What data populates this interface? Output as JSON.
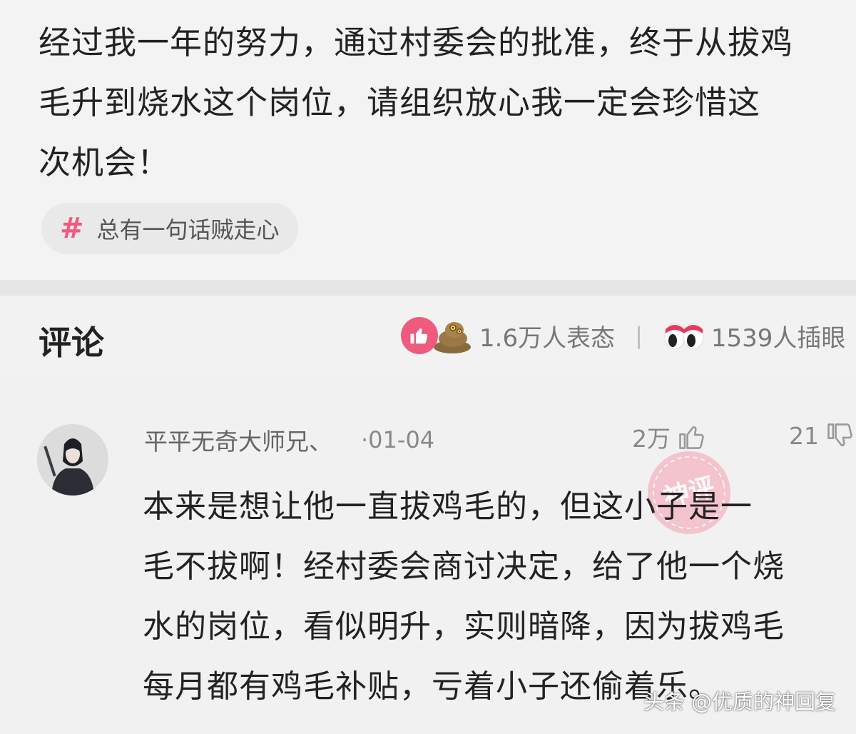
{
  "post": {
    "text": "经过我一年的努力，通过村委会的批准，终于从拔鸡\n毛升到烧水这个岗位，请组织放心我一定会珍惜这\n次机会！",
    "topic": {
      "hash": "#",
      "label": "总有一句话贼走心"
    }
  },
  "comments_header": {
    "title": "评论",
    "reactions_text": "1.6万人表态",
    "separator": "|",
    "eyes_text": "1539人插眼",
    "icons": [
      "like-reaction-icon",
      "poop-reaction-icon",
      "eyes-reaction-icon"
    ]
  },
  "comment": {
    "user": "平平无奇大师兄、",
    "date": "·01-04",
    "likes": "2万",
    "dislikes": "21",
    "stamp_label": "神评",
    "text": "本来是想让他一直拔鸡毛的，但这小子是一\n毛不拔啊！经村委会商讨决定，给了他一个烧\n水的岗位，看似明升，实则暗降，因为拔鸡毛\n每月都有鸡毛补贴，亏着小子还偷着乐。"
  },
  "watermark": "头条 @优质的神回复",
  "colors": {
    "accent_pink": "#ef5a7e",
    "background": "#efefef",
    "muted_text": "#777777"
  }
}
